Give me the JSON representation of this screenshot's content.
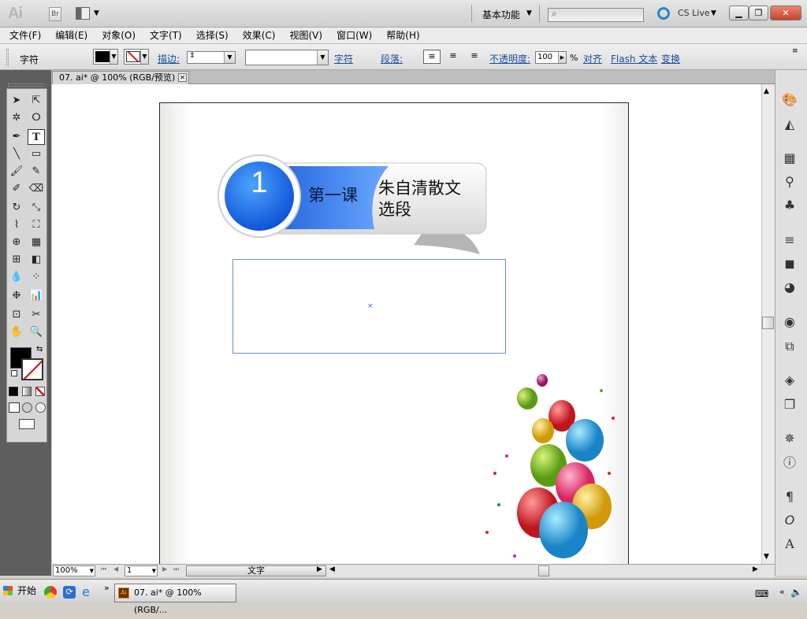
{
  "app": {
    "logo": "Ai",
    "bridge_label": "Br",
    "workspace": "基本功能",
    "cslive": "CS Live"
  },
  "menus": [
    "文件(F)",
    "编辑(E)",
    "对象(O)",
    "文字(T)",
    "选择(S)",
    "效果(C)",
    "视图(V)",
    "窗口(W)",
    "帮助(H)"
  ],
  "controlbar": {
    "object_type": "字符",
    "stroke_label": "描边:",
    "char_link": "字符",
    "para_link": "段落:",
    "opacity_label": "不透明度:",
    "opacity_value": "100",
    "percent": "%",
    "align_link": "对齐",
    "flash_link": "Flash 文本",
    "transform_link": "变换"
  },
  "document": {
    "tab_title": "07. ai* @ 100% (RGB/预览)",
    "lesson_number": "1",
    "lesson_title": "第一课",
    "lesson_subtitle_line1": "朱自清散文",
    "lesson_subtitle_line2": "选段"
  },
  "statusbar": {
    "zoom": "100%",
    "artboard_num": "1",
    "tool_name": "文字"
  },
  "taskbar": {
    "start": "开始",
    "task_item": "07. ai* @ 100% (RGB/...",
    "expand": "»"
  },
  "colors": {
    "badge_blue": "#1d6ff2",
    "fill": "#000000"
  }
}
